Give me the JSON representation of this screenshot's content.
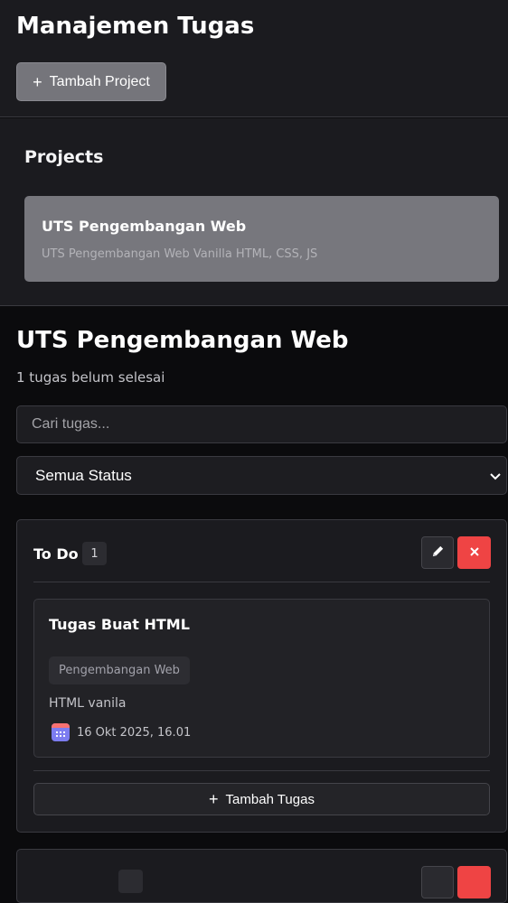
{
  "header": {
    "title": "Manajemen Tugas",
    "add_project_label": "Tambah Project",
    "plus_glyph": "+"
  },
  "projects": {
    "heading": "Projects",
    "items": [
      {
        "title": "UTS Pengembangan Web",
        "description": "UTS Pengembangan Web Vanilla HTML, CSS, JS"
      }
    ]
  },
  "main": {
    "project_title": "UTS Pengembangan Web",
    "pending_text": "1 tugas belum selesai",
    "search_placeholder": "Cari tugas...",
    "status_filter_value": "Semua Status"
  },
  "columns": [
    {
      "title": "To Do",
      "count": "1",
      "tasks": [
        {
          "title": "Tugas Buat HTML",
          "tag": "Pengembangan Web",
          "description": "HTML vanila",
          "date": "16 Okt 2025, 16.01"
        }
      ],
      "add_task_label": "Tambah Tugas"
    }
  ],
  "icons": {
    "edit": "pencil-icon",
    "delete": "close-icon",
    "calendar": "calendar-icon",
    "dropdown": "chevron-down-icon"
  },
  "colors": {
    "background": "#0b0b0d",
    "panel": "#1b1b1f",
    "danger": "#ef4444",
    "project_card": "#77777d"
  }
}
